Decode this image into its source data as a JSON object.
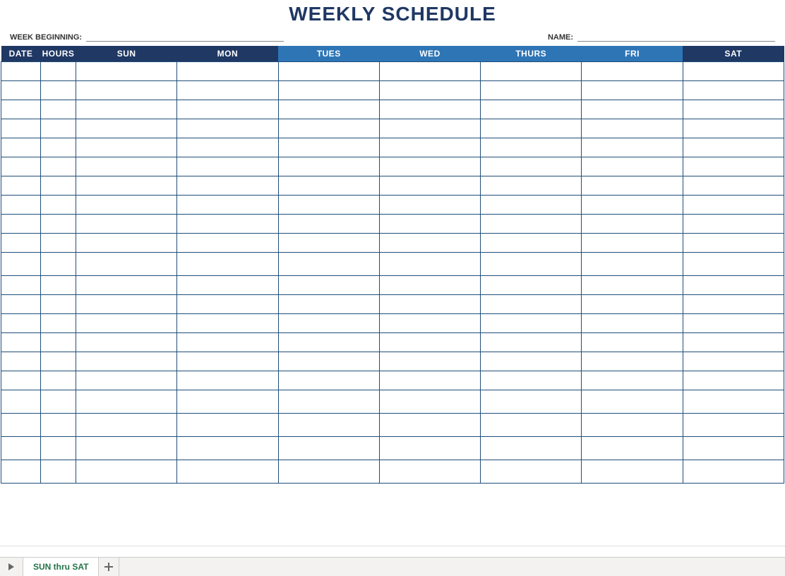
{
  "title": "WEEKLY SCHEDULE",
  "fields": {
    "week_beginning_label": "WEEK BEGINNING:",
    "week_beginning_value": "",
    "name_label": "NAME:",
    "name_value": ""
  },
  "columns": {
    "date": {
      "label": "DATE",
      "style": "dark"
    },
    "hours": {
      "label": "HOURS",
      "style": "dark"
    },
    "sun": {
      "label": "SUN",
      "style": "dark"
    },
    "mon": {
      "label": "MON",
      "style": "dark"
    },
    "tues": {
      "label": "TUES",
      "style": "blue"
    },
    "wed": {
      "label": "WED",
      "style": "blue"
    },
    "thurs": {
      "label": "THURS",
      "style": "blue"
    },
    "fri": {
      "label": "FRI",
      "style": "blue"
    },
    "sat": {
      "label": "SAT",
      "style": "dark"
    }
  },
  "rows": [
    {
      "date": "",
      "hours": "",
      "sun": "",
      "mon": "",
      "tues": "",
      "wed": "",
      "thurs": "",
      "fri": "",
      "sat": ""
    },
    {
      "date": "",
      "hours": "",
      "sun": "",
      "mon": "",
      "tues": "",
      "wed": "",
      "thurs": "",
      "fri": "",
      "sat": ""
    },
    {
      "date": "",
      "hours": "",
      "sun": "",
      "mon": "",
      "tues": "",
      "wed": "",
      "thurs": "",
      "fri": "",
      "sat": ""
    },
    {
      "date": "",
      "hours": "",
      "sun": "",
      "mon": "",
      "tues": "",
      "wed": "",
      "thurs": "",
      "fri": "",
      "sat": ""
    },
    {
      "date": "",
      "hours": "",
      "sun": "",
      "mon": "",
      "tues": "",
      "wed": "",
      "thurs": "",
      "fri": "",
      "sat": ""
    },
    {
      "date": "",
      "hours": "",
      "sun": "",
      "mon": "",
      "tues": "",
      "wed": "",
      "thurs": "",
      "fri": "",
      "sat": ""
    },
    {
      "date": "",
      "hours": "",
      "sun": "",
      "mon": "",
      "tues": "",
      "wed": "",
      "thurs": "",
      "fri": "",
      "sat": ""
    },
    {
      "date": "",
      "hours": "",
      "sun": "",
      "mon": "",
      "tues": "",
      "wed": "",
      "thurs": "",
      "fri": "",
      "sat": ""
    },
    {
      "date": "",
      "hours": "",
      "sun": "",
      "mon": "",
      "tues": "",
      "wed": "",
      "thurs": "",
      "fri": "",
      "sat": ""
    },
    {
      "date": "",
      "hours": "",
      "sun": "",
      "mon": "",
      "tues": "",
      "wed": "",
      "thurs": "",
      "fri": "",
      "sat": ""
    },
    {
      "date": "",
      "hours": "",
      "sun": "",
      "mon": "",
      "tues": "",
      "wed": "",
      "thurs": "",
      "fri": "",
      "sat": ""
    },
    {
      "date": "",
      "hours": "",
      "sun": "",
      "mon": "",
      "tues": "",
      "wed": "",
      "thurs": "",
      "fri": "",
      "sat": ""
    },
    {
      "date": "",
      "hours": "",
      "sun": "",
      "mon": "",
      "tues": "",
      "wed": "",
      "thurs": "",
      "fri": "",
      "sat": ""
    },
    {
      "date": "",
      "hours": "",
      "sun": "",
      "mon": "",
      "tues": "",
      "wed": "",
      "thurs": "",
      "fri": "",
      "sat": ""
    },
    {
      "date": "",
      "hours": "",
      "sun": "",
      "mon": "",
      "tues": "",
      "wed": "",
      "thurs": "",
      "fri": "",
      "sat": ""
    },
    {
      "date": "",
      "hours": "",
      "sun": "",
      "mon": "",
      "tues": "",
      "wed": "",
      "thurs": "",
      "fri": "",
      "sat": ""
    },
    {
      "date": "",
      "hours": "",
      "sun": "",
      "mon": "",
      "tues": "",
      "wed": "",
      "thurs": "",
      "fri": "",
      "sat": ""
    },
    {
      "date": "",
      "hours": "",
      "sun": "",
      "mon": "",
      "tues": "",
      "wed": "",
      "thurs": "",
      "fri": "",
      "sat": ""
    },
    {
      "date": "",
      "hours": "",
      "sun": "",
      "mon": "",
      "tues": "",
      "wed": "",
      "thurs": "",
      "fri": "",
      "sat": ""
    },
    {
      "date": "",
      "hours": "",
      "sun": "",
      "mon": "",
      "tues": "",
      "wed": "",
      "thurs": "",
      "fri": "",
      "sat": ""
    },
    {
      "date": "",
      "hours": "",
      "sun": "",
      "mon": "",
      "tues": "",
      "wed": "",
      "thurs": "",
      "fri": "",
      "sat": ""
    }
  ],
  "sheet_tab": "SUN thru SAT"
}
